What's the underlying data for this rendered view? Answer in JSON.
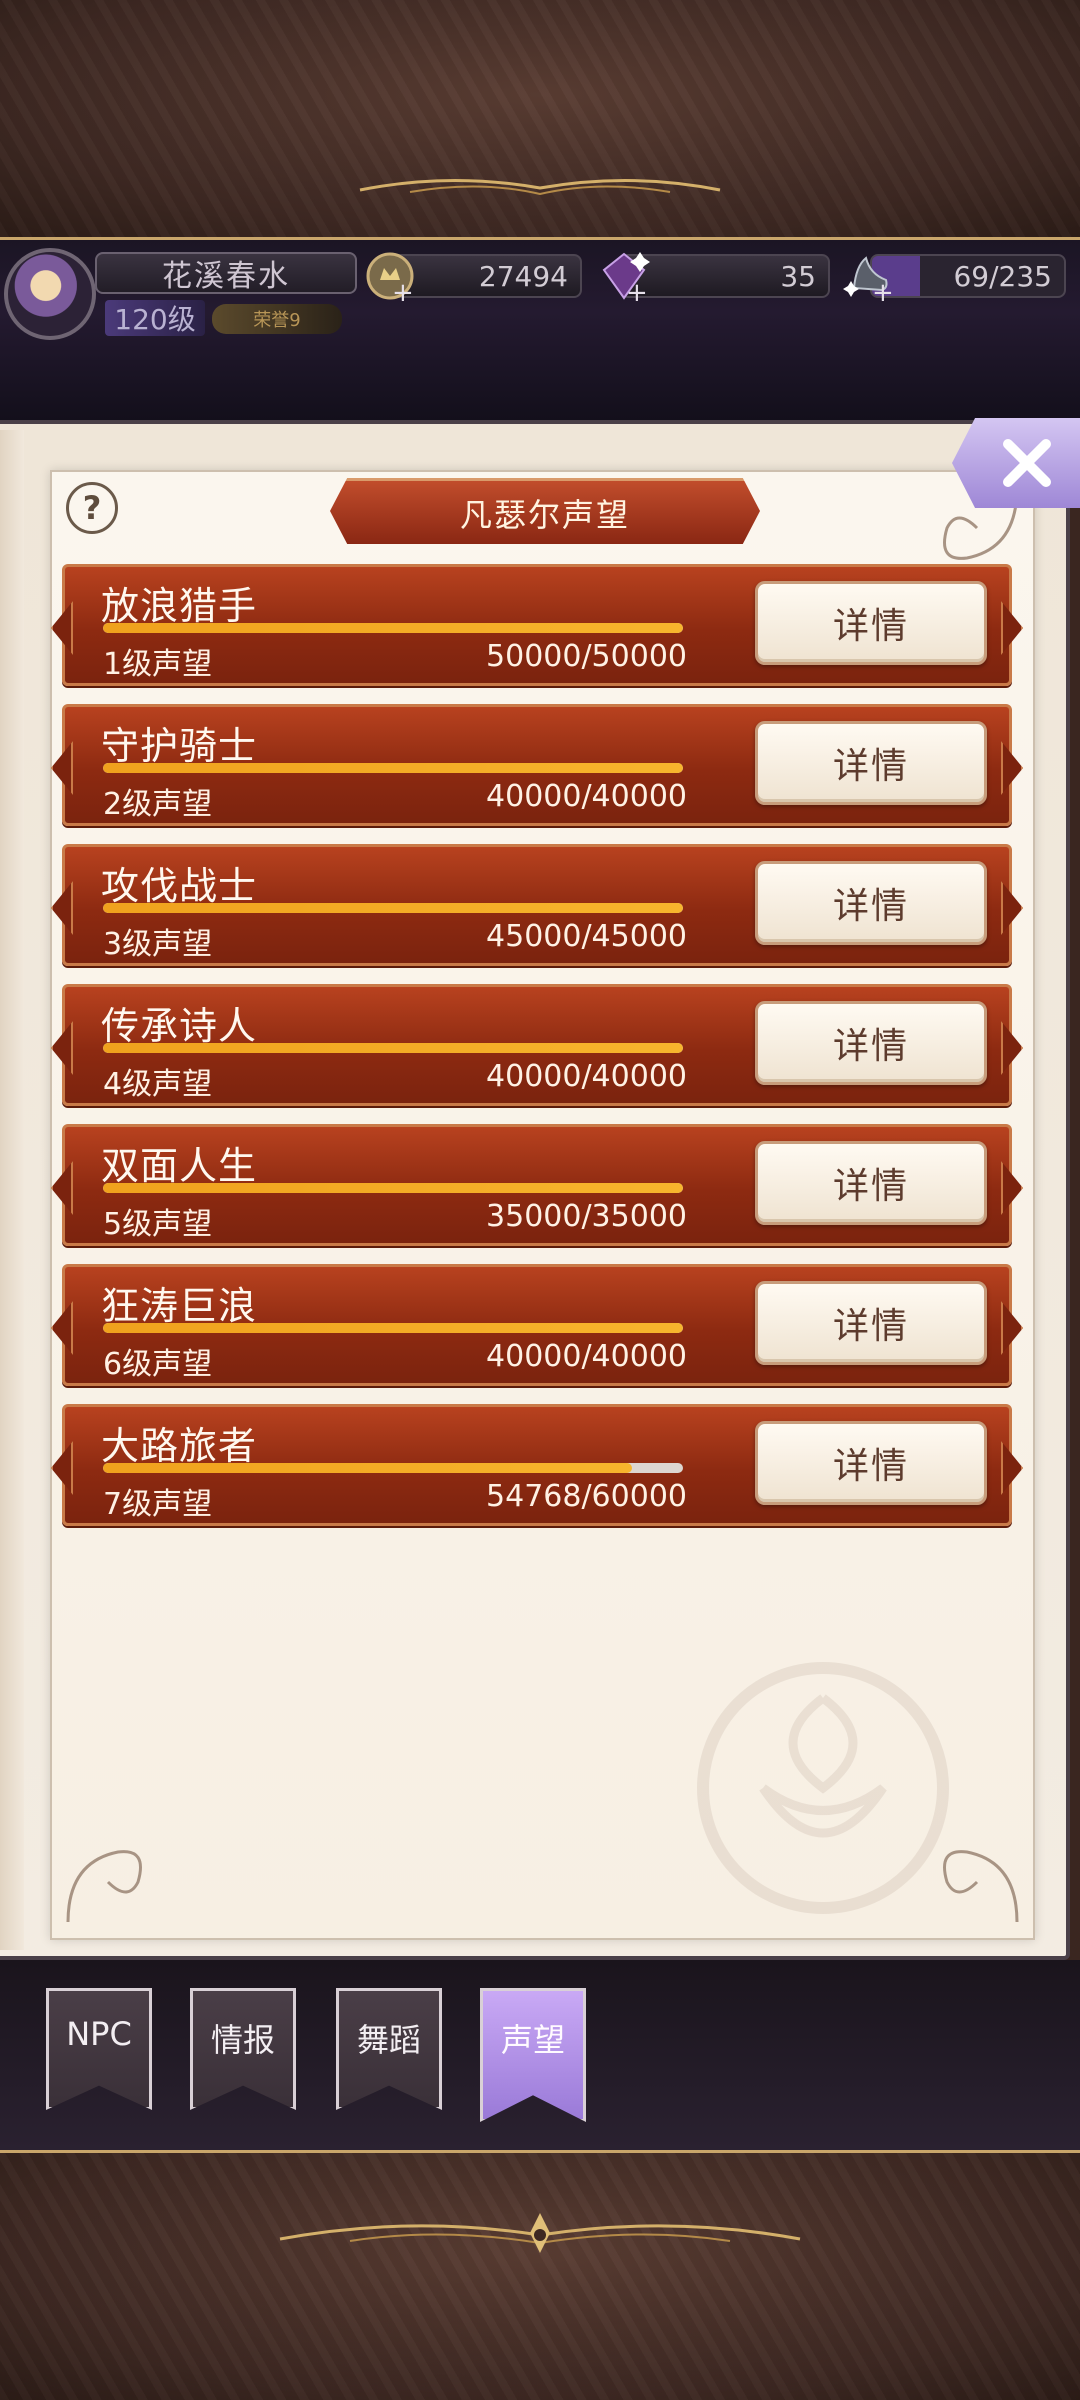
{
  "player": {
    "name": "花溪春水",
    "level": "120级",
    "badge": "荣誉9"
  },
  "resources": {
    "gold": "27494",
    "gems": "35",
    "stamina": "69/235"
  },
  "panel": {
    "title": "凡瑟尔声望",
    "help": "?"
  },
  "reputations": [
    {
      "name": "放浪猎手",
      "level": "1级声望",
      "value": "50000/50000",
      "progress": 1.0,
      "button": "详情"
    },
    {
      "name": "守护骑士",
      "level": "2级声望",
      "value": "40000/40000",
      "progress": 1.0,
      "button": "详情"
    },
    {
      "name": "攻伐战士",
      "level": "3级声望",
      "value": "45000/45000",
      "progress": 1.0,
      "button": "详情"
    },
    {
      "name": "传承诗人",
      "level": "4级声望",
      "value": "40000/40000",
      "progress": 1.0,
      "button": "详情"
    },
    {
      "name": "双面人生",
      "level": "5级声望",
      "value": "35000/35000",
      "progress": 1.0,
      "button": "详情"
    },
    {
      "name": "狂涛巨浪",
      "level": "6级声望",
      "value": "40000/40000",
      "progress": 1.0,
      "button": "详情"
    },
    {
      "name": "大路旅者",
      "level": "7级声望",
      "value": "54768/60000",
      "progress": 0.9128,
      "button": "详情"
    }
  ],
  "tabs": [
    {
      "label": "NPC",
      "active": false
    },
    {
      "label": "情报",
      "active": false
    },
    {
      "label": "舞蹈",
      "active": false
    },
    {
      "label": "声望",
      "active": true
    }
  ],
  "colors": {
    "accent": "#b9a0ec",
    "row": "#9a3216",
    "progress": "#f2a71f"
  }
}
